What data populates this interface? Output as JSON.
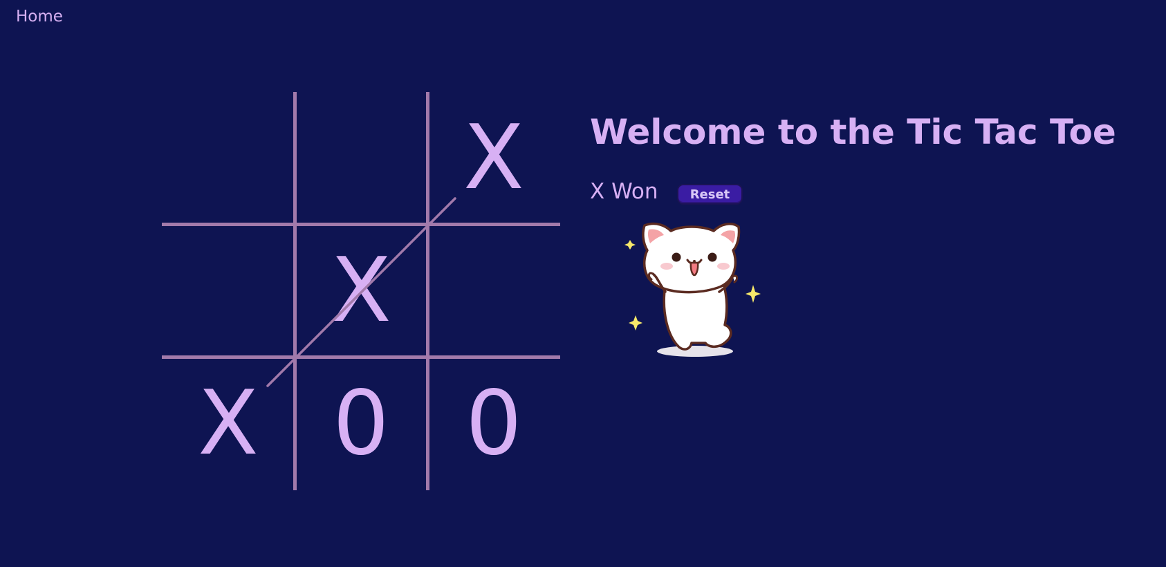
{
  "nav": {
    "home_label": "Home"
  },
  "game": {
    "title": "Welcome to the Tic Tac Toe",
    "status": "X Won",
    "reset_label": "Reset",
    "board": [
      "",
      "",
      "X",
      "",
      "X",
      "",
      "X",
      "0",
      "0"
    ],
    "winner": "X",
    "winning_line": [
      2,
      4,
      6
    ]
  },
  "colors": {
    "background": "#0e1452",
    "mark": "#d7b0f4",
    "grid": "#a27aab",
    "button": "#3a1ca3"
  },
  "illustration": {
    "icon": "happy-cat-sticker"
  }
}
